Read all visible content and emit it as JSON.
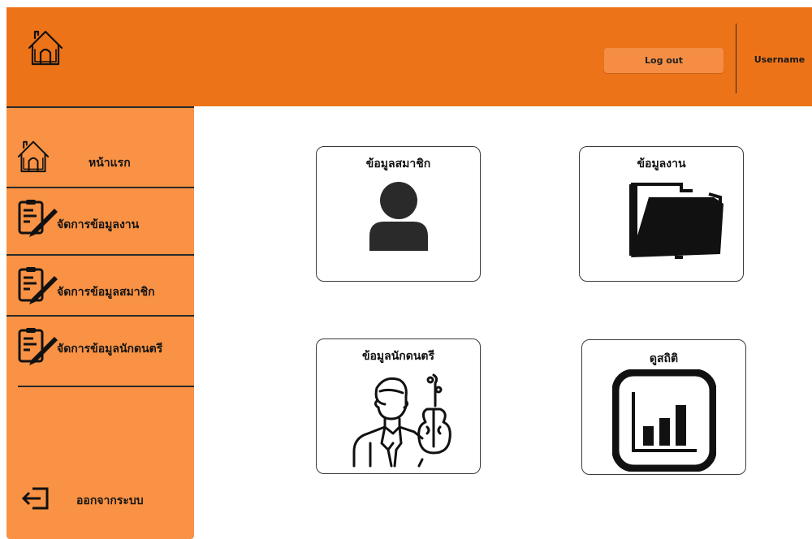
{
  "header": {
    "logout_label": "Log out",
    "username": "Username",
    "bg_color": "#ed7319"
  },
  "sidebar": {
    "bg_color": "#f99244",
    "items": [
      {
        "label": "หน้าแรก",
        "icon": "home-icon"
      },
      {
        "label": "จัดการข้อมูลงาน",
        "icon": "document-edit-icon"
      },
      {
        "label": "จัดการข้อมูลสมาชิก",
        "icon": "document-edit-icon"
      },
      {
        "label": "จัดการข้อมูลนักดนตรี",
        "icon": "document-edit-icon"
      }
    ],
    "logout_label": "ออกจากระบบ"
  },
  "cards": [
    {
      "title": "ข้อมูลสมาชิก",
      "icon": "user-icon"
    },
    {
      "title": "ข้อมูลงาน",
      "icon": "folder-icon"
    },
    {
      "title": "ข้อมูลนักดนตรี",
      "icon": "musician-violin-icon"
    },
    {
      "title": "ดูสถิติ",
      "icon": "bar-chart-icon"
    }
  ]
}
